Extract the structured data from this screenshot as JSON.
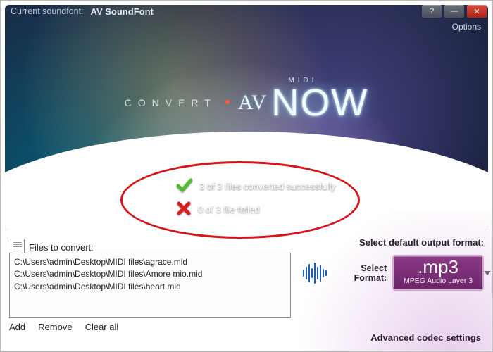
{
  "titlebar": {
    "soundfont_label": "Current soundfont:",
    "soundfont_name": "AV SoundFont",
    "options_label": "Options"
  },
  "logo": {
    "midi": "MIDI",
    "convert": "CONVERT",
    "av": "AV",
    "now": "NOW"
  },
  "status": {
    "success_text": "3 of 3 files converted successfully",
    "failed_text": "0 of 3 file failed"
  },
  "files": {
    "label": "Files to convert:",
    "items": [
      "C:\\Users\\admin\\Desktop\\MIDI files\\agrace.mid",
      "C:\\Users\\admin\\Desktop\\MIDI files\\Amore mio.mid",
      "C:\\Users\\admin\\Desktop\\MIDI files\\heart.mid"
    ],
    "actions": {
      "add": "Add",
      "remove": "Remove",
      "clear": "Clear all"
    }
  },
  "output": {
    "header": "Select default output format:",
    "select_label": "Select Format:",
    "format_ext": ".mp3",
    "format_desc": "MPEG Audio Layer 3",
    "advanced_label": "Advanced codec settings"
  }
}
